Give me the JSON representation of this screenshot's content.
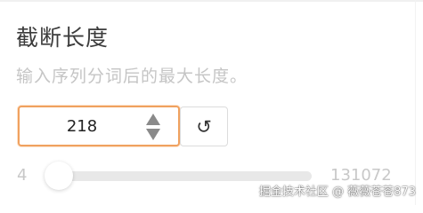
{
  "setting": {
    "title": "截断长度",
    "description": "输入序列分词后的最大长度。"
  },
  "number_input": {
    "value": "218",
    "increment_icon": "triangle-up-icon",
    "decrement_icon": "triangle-down-icon"
  },
  "reset": {
    "icon": "reset-icon",
    "glyph": "↺"
  },
  "slider": {
    "min_label": "4",
    "max_label": "131072",
    "min": 4,
    "max": 131072,
    "value": 218
  },
  "watermark": {
    "text": "掘金技术社区 @ 薇薇苍苍873"
  },
  "colors": {
    "accent": "#f0a15f",
    "muted_text": "#c5c5c5"
  }
}
